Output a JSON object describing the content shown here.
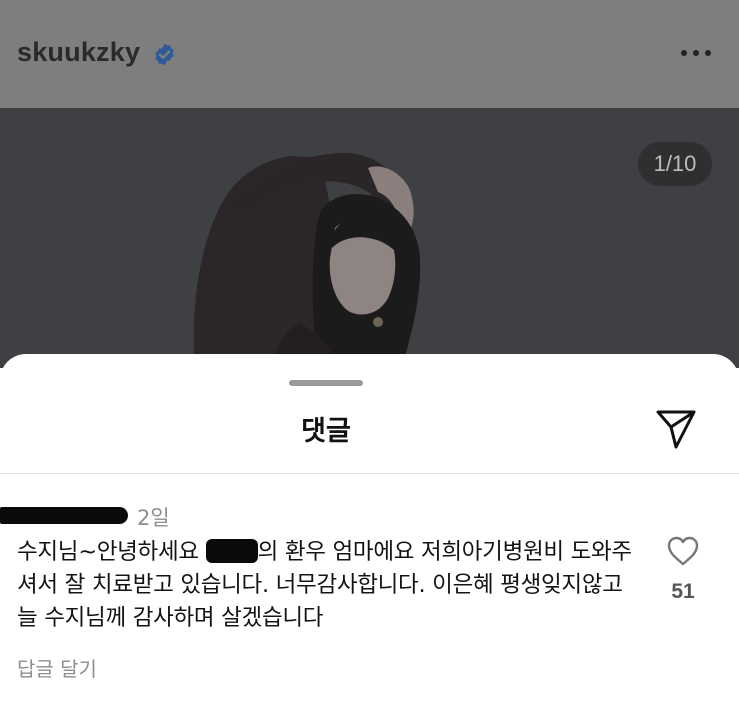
{
  "post_header": {
    "username": "skuukzky",
    "verified_icon": "verified-badge-icon",
    "more_icon": "more-options-icon"
  },
  "photo": {
    "page_counter": "1/10"
  },
  "comments_sheet": {
    "title": "댓글",
    "send_icon": "send-icon"
  },
  "comment": {
    "time": "2일",
    "text_part1": "수지님~안녕하세요 ",
    "text_part2": "의 환우 엄마에요 저희아기병원비 도와주셔서 잘 치료받고 있습니다. 너무감사합니다. 이은혜 평생잊지않고 늘 수지님께 감사하며 살겠습니다",
    "reply_label": "답글 달기",
    "like_icon": "heart-icon",
    "like_count": "51"
  },
  "colors": {
    "dim_header": "#7e7e7e",
    "dim_photo": "#3f4043",
    "verified_blue": "#2d6cc9",
    "text": "#141414",
    "muted": "#8e8e8e"
  }
}
